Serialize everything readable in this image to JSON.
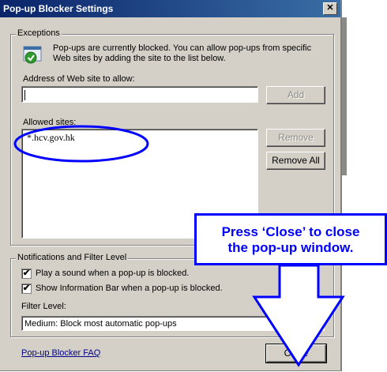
{
  "window": {
    "title": "Pop-up Blocker Settings",
    "close_glyph": "✕"
  },
  "exceptions": {
    "legend": "Exceptions",
    "info_line1": "Pop-ups are currently blocked.  You can allow pop-ups from specific",
    "info_line2": "Web sites by adding the site to the list below.",
    "address_label": "Address of Web site to allow:",
    "address_value": "",
    "add_label": "Add",
    "allowed_label": "Allowed sites:",
    "allowed_sites": [
      "*.hcv.gov.hk"
    ],
    "remove_label": "Remove",
    "remove_all_label": "Remove All"
  },
  "notifications": {
    "legend": "Notifications and Filter Level",
    "play_sound_label": "Play a sound when a pop-up is blocked.",
    "play_sound_checked": true,
    "show_infobar_label": "Show Information Bar when a pop-up is blocked.",
    "show_infobar_checked": true,
    "filter_label": "Filter Level:",
    "filter_value": "Medium: Block most automatic pop-ups"
  },
  "footer": {
    "faq_link": "Pop-up Blocker FAQ",
    "close_label": "Close"
  },
  "annotation": {
    "callout_line1": "Press ‘Close’ to close",
    "callout_line2": "the pop-up window.",
    "color": "#0000ff"
  },
  "icons": {
    "info": "shield-check-icon",
    "check": "✔",
    "dropdown": "▼"
  }
}
